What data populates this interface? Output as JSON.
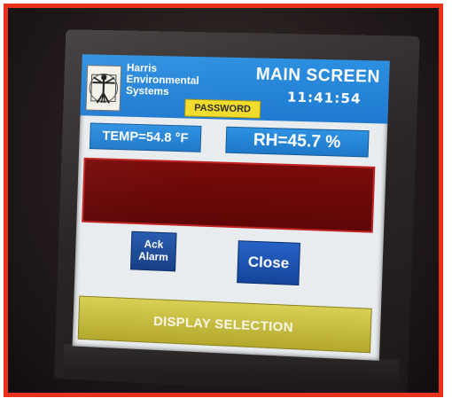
{
  "screen": {
    "title": "MAIN SCREEN",
    "clock": "11:41:54"
  },
  "company": {
    "line1": "Harris",
    "line2": "Environmental",
    "line3": "Systems",
    "logo_icon": "vitruvian-man-logo"
  },
  "buttons": {
    "password": "PASSWORD",
    "ack_line1": "Ack",
    "ack_line2": "Alarm",
    "close": "Close",
    "display_selection": "DISPLAY SELECTION"
  },
  "readouts": {
    "temperature": "TEMP=54.8 °F",
    "humidity": "RH=45.7 %"
  },
  "colors": {
    "header_blue": "#1f7ad0",
    "password_yellow": "#f2dc2a",
    "alarm_red": "#6b0808",
    "button_blue": "#1a4d9e",
    "selection_yellow": "#c4ba3a",
    "frame_red": "#e8321c"
  }
}
